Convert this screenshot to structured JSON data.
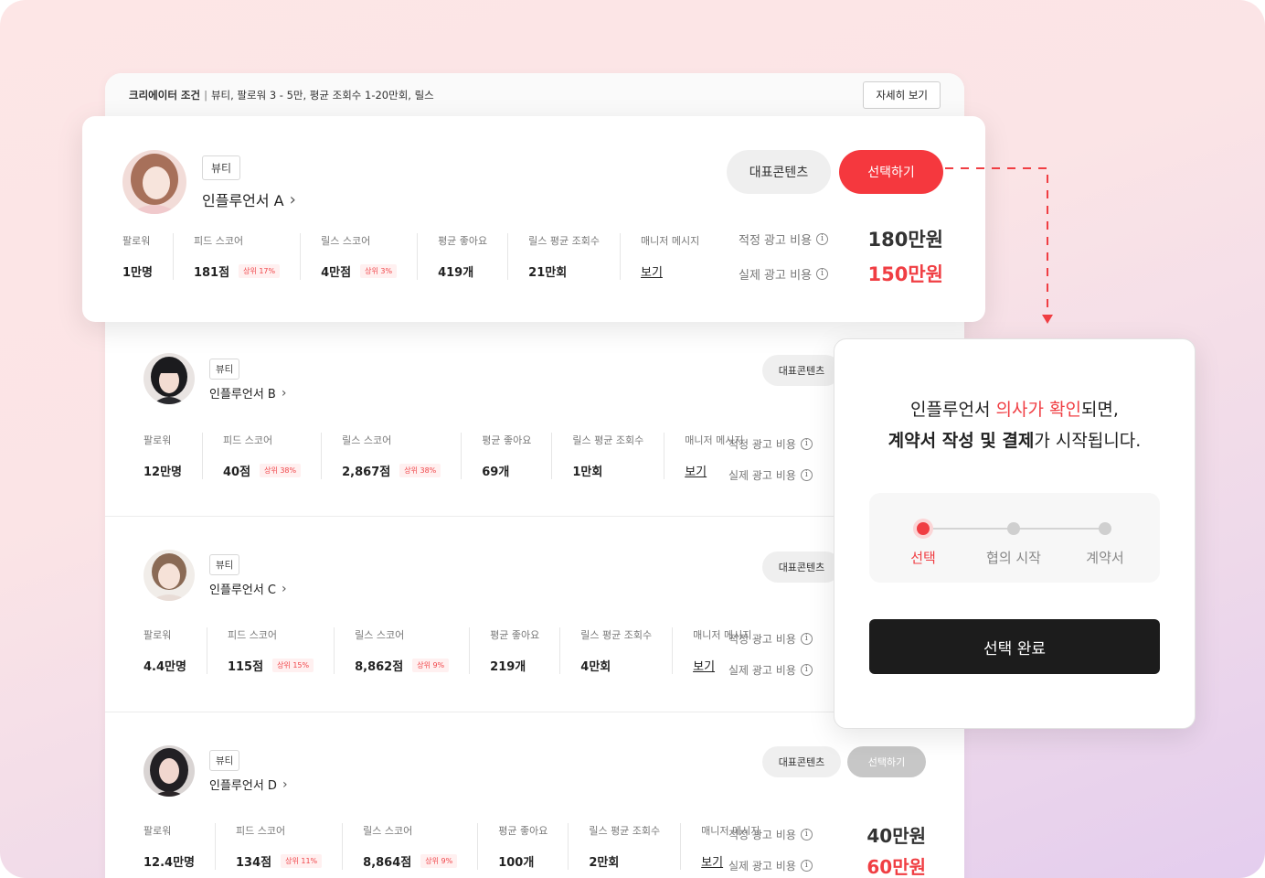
{
  "condition": {
    "label": "크리에이터 조건",
    "text": "뷰티, 팔로워 3 - 5만, 평균 조회수 1-20만회, 릴스",
    "detail_button": "자세히 보기"
  },
  "stat_labels": {
    "followers": "팔로워",
    "feed_score": "피드 스코어",
    "reels_score": "릴스 스코어",
    "avg_likes": "평균 좋아요",
    "reels_avg_views": "릴스 평균 조회수",
    "manager_msg": "매니저 메시지",
    "std_cost": "적정 광고 비용",
    "real_cost": "실제 광고 비용"
  },
  "buttons": {
    "content": "대표콘텐츠",
    "select": "선택하기",
    "view": "보기"
  },
  "influencers": [
    {
      "tag": "뷰티",
      "name": "인플루언서 A",
      "followers": "1만명",
      "feed_score": "181점",
      "feed_rank": "상위 17%",
      "reels_score": "4만점",
      "reels_rank": "상위 3%",
      "avg_likes": "419개",
      "reels_avg_views": "21만회",
      "std_cost": "180만원",
      "real_cost": "150만원"
    },
    {
      "tag": "뷰티",
      "name": "인플루언서 B",
      "followers": "12만명",
      "feed_score": "40점",
      "feed_rank": "상위 38%",
      "reels_score": "2,867점",
      "reels_rank": "상위 38%",
      "avg_likes": "69개",
      "reels_avg_views": "1만회"
    },
    {
      "tag": "뷰티",
      "name": "인플루언서 C",
      "followers": "4.4만명",
      "feed_score": "115점",
      "feed_rank": "상위 15%",
      "reels_score": "8,862점",
      "reels_rank": "상위 9%",
      "avg_likes": "219개",
      "reels_avg_views": "4만회"
    },
    {
      "tag": "뷰티",
      "name": "인플루언서 D",
      "followers": "12.4만명",
      "feed_score": "134점",
      "feed_rank": "상위 11%",
      "reels_score": "8,864점",
      "reels_rank": "상위 9%",
      "avg_likes": "100개",
      "reels_avg_views": "2만회",
      "std_cost": "40만원",
      "real_cost": "60만원"
    }
  ],
  "popup": {
    "line1_pre": "인플루언서 ",
    "line1_highlight": "의사가 확인",
    "line1_post": "되면,",
    "line2_bold": "계약서 작성 및 결제",
    "line2_post": "가 시작됩니다.",
    "steps": [
      "선택",
      "협의 시작",
      "계약서"
    ],
    "active_step": 0,
    "confirm_button": "선택 완료"
  },
  "colors": {
    "accent": "#f03e43",
    "button_dark": "#1c1c1c",
    "disabled": "#c7c7c7"
  }
}
